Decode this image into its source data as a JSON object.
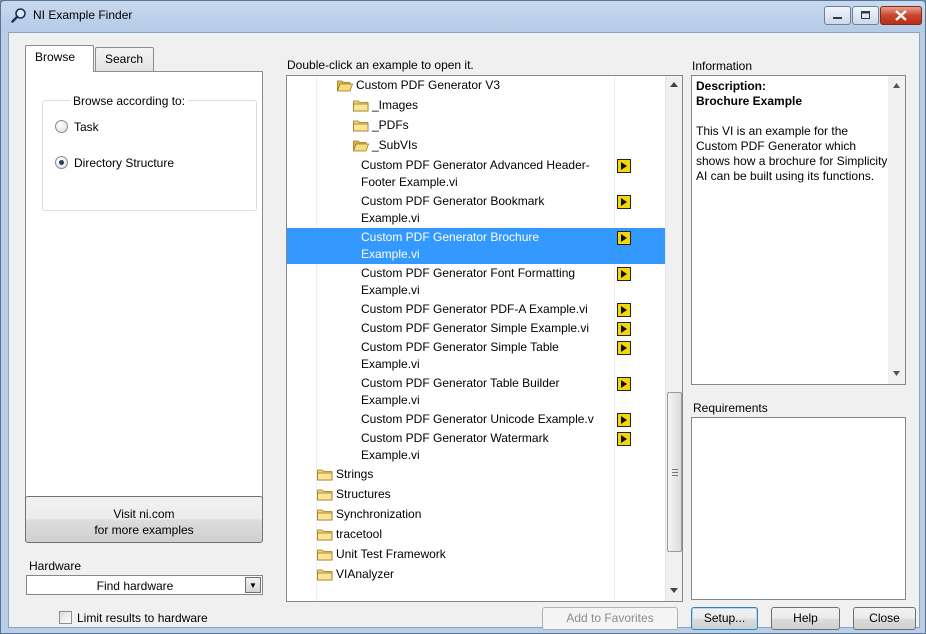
{
  "window": {
    "title": "NI Example Finder",
    "buttons": [
      "minimize",
      "maximize",
      "close"
    ]
  },
  "tabs": [
    {
      "label": "Browse",
      "active": true
    },
    {
      "label": "Search",
      "active": false
    }
  ],
  "browse": {
    "group_label": "Browse according to:",
    "options": [
      {
        "label": "Task",
        "selected": false
      },
      {
        "label": "Directory Structure",
        "selected": true
      }
    ]
  },
  "visit": {
    "line1": "Visit ni.com",
    "line2": "for more examples"
  },
  "hardware": {
    "label": "Hardware",
    "combo_value": "Find hardware",
    "limit_label": "Limit results to hardware",
    "limit_checked": false
  },
  "tree": {
    "instruction": "Double-click an example to open it.",
    "rows": [
      {
        "type": "folder-open",
        "indent": 1,
        "text": "Custom PDF Generator V3"
      },
      {
        "type": "folder",
        "indent": 2,
        "text": "_Images"
      },
      {
        "type": "folder",
        "indent": 2,
        "text": "_PDFs"
      },
      {
        "type": "folder-open",
        "indent": 2,
        "text": "_SubVIs"
      },
      {
        "type": "vi",
        "lines": [
          "Custom PDF Generator Advanced Header-",
          "Footer Example.vi"
        ]
      },
      {
        "type": "vi",
        "lines": [
          "Custom PDF Generator Bookmark",
          "Example.vi"
        ]
      },
      {
        "type": "vi",
        "selected": true,
        "lines": [
          "Custom PDF Generator Brochure",
          "Example.vi"
        ]
      },
      {
        "type": "vi",
        "lines": [
          "Custom PDF Generator Font Formatting",
          "Example.vi"
        ]
      },
      {
        "type": "vi",
        "lines": [
          "Custom PDF Generator PDF-A Example.vi"
        ]
      },
      {
        "type": "vi",
        "lines": [
          "Custom PDF Generator Simple Example.vi"
        ]
      },
      {
        "type": "vi",
        "lines": [
          "Custom PDF Generator Simple Table",
          "Example.vi"
        ]
      },
      {
        "type": "vi",
        "lines": [
          "Custom PDF Generator Table Builder",
          "Example.vi"
        ]
      },
      {
        "type": "vi",
        "lines": [
          "Custom PDF Generator Unicode Example.v"
        ]
      },
      {
        "type": "vi",
        "lines": [
          "Custom PDF Generator Watermark",
          "Example.vi"
        ]
      },
      {
        "type": "folder",
        "indent": 0,
        "text": "Strings"
      },
      {
        "type": "folder",
        "indent": 0,
        "text": "Structures"
      },
      {
        "type": "folder",
        "indent": 0,
        "text": "Synchronization"
      },
      {
        "type": "folder",
        "indent": 0,
        "text": "tracetool"
      },
      {
        "type": "folder",
        "indent": 0,
        "text": "Unit Test Framework"
      },
      {
        "type": "folder",
        "indent": 0,
        "text": "VIAnalyzer"
      }
    ]
  },
  "information": {
    "label": "Information",
    "desc_heading": "Description:",
    "desc_title": "Brochure Example",
    "desc_body": "This VI is an example for the Custom PDF Generator which shows how a brochure for Simplicity AI can be built using its functions."
  },
  "requirements": {
    "label": "Requirements"
  },
  "buttons": {
    "add_favorites": "Add to Favorites",
    "setup": "Setup...",
    "help": "Help",
    "close": "Close"
  },
  "colors": {
    "selection": "#3399ff",
    "vi_icon": "#f6d60b",
    "folder": "#f5d56a"
  }
}
